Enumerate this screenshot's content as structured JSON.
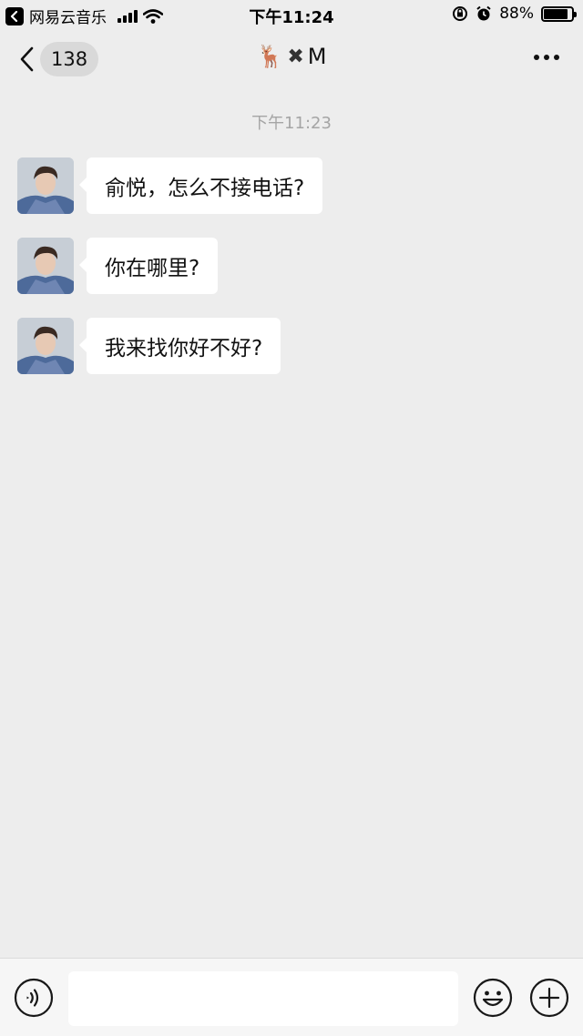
{
  "status_bar": {
    "back_app": "网易云音乐",
    "time": "下午11:24",
    "battery": "88%",
    "battery_level": 0.88
  },
  "nav": {
    "unread_count": "138",
    "title_suffix": "M",
    "title_emoji": "🦌",
    "title_cross": "✖"
  },
  "chat": {
    "timestamp": "下午11:23",
    "messages": [
      {
        "text": "俞悦，怎么不接电话?"
      },
      {
        "text": "你在哪里?"
      },
      {
        "text": "我来找你好不好?"
      }
    ]
  },
  "input": {
    "value": "",
    "placeholder": ""
  },
  "icons": {
    "back": "chevron-left-icon",
    "more": "more-dots-icon",
    "voice": "voice-icon",
    "emoji": "emoji-icon",
    "plus": "plus-icon"
  }
}
